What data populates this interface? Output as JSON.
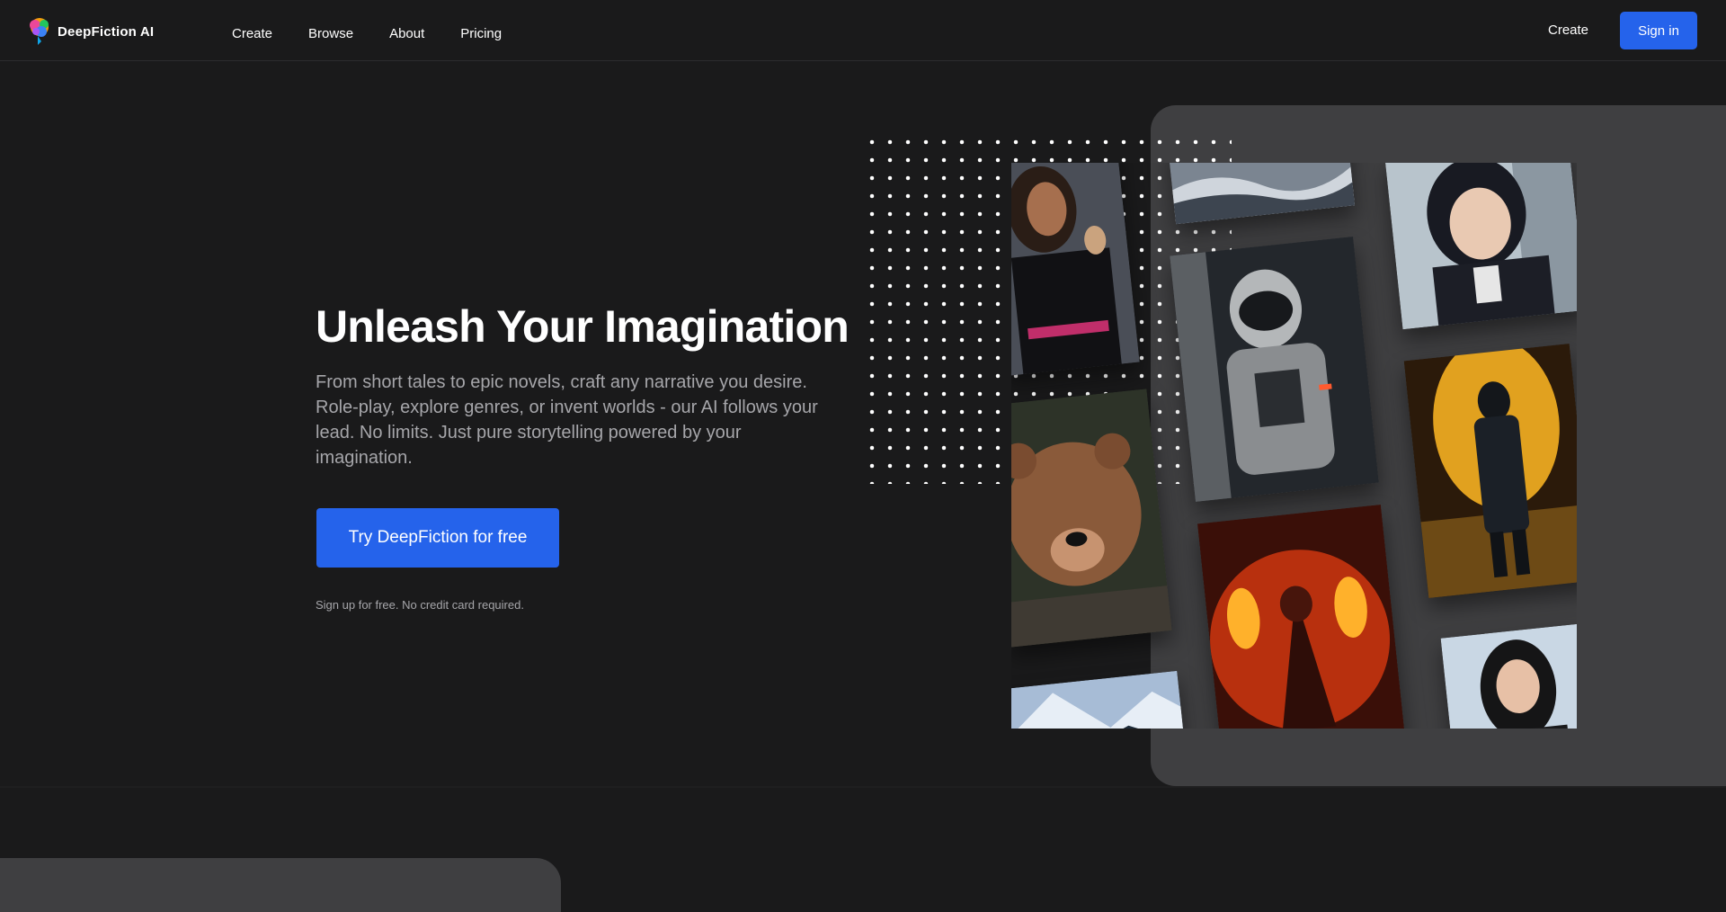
{
  "brand": {
    "name": "DeepFiction AI"
  },
  "nav": {
    "items": [
      {
        "label": "Create"
      },
      {
        "label": "Browse"
      },
      {
        "label": "About"
      },
      {
        "label": "Pricing"
      }
    ],
    "create_label": "Create",
    "signin_label": "Sign in"
  },
  "hero": {
    "title": "Unleash Your Imagination",
    "subtitle": "From short tales to epic novels, craft any narrative you desire. Role-play, explore genres, or invent worlds - our AI follows your lead. No limits. Just pure storytelling powered by your imagination.",
    "cta_label": "Try DeepFiction for free",
    "note": "Sign up for free. No credit card required."
  },
  "gallery": {
    "images": [
      {
        "name": "woman-in-uniform-image"
      },
      {
        "name": "snowy-landscape-image"
      },
      {
        "name": "anime-girl-image"
      },
      {
        "name": "armored-astronaut-image"
      },
      {
        "name": "bear-image"
      },
      {
        "name": "dark-knight-image"
      },
      {
        "name": "fire-mage-image"
      },
      {
        "name": "mountain-forest-image"
      },
      {
        "name": "woman-portrait-image"
      }
    ]
  },
  "colors": {
    "background": "#1a1a1b",
    "accent": "#2563eb",
    "panel": "#3f3f41",
    "muted_text": "#a6a6aa"
  }
}
